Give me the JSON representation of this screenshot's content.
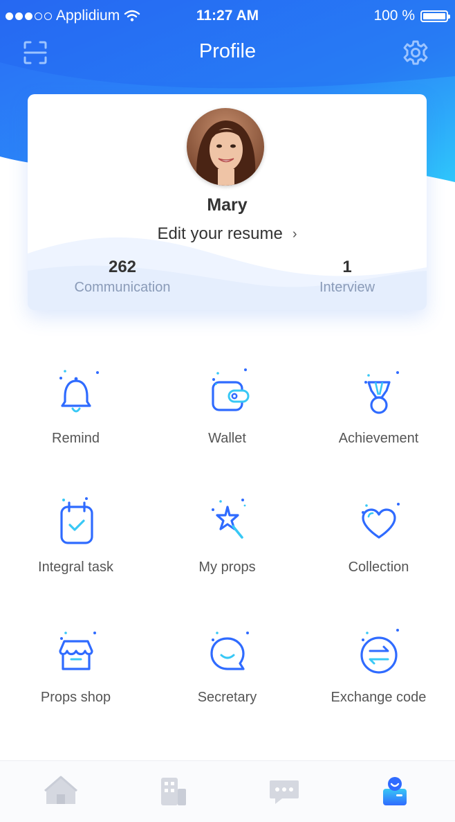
{
  "status_bar": {
    "carrier": "Applidium",
    "time": "11:27 AM",
    "battery": "100 %",
    "icons": [
      "signal-dots",
      "wifi-icon",
      "battery-icon"
    ]
  },
  "nav": {
    "title": "Profile",
    "left_icon": "scan-icon",
    "right_icon": "gear-icon"
  },
  "profile": {
    "name": "Mary",
    "edit_label": "Edit your resume",
    "edit_chevron": "›",
    "stats": [
      {
        "value": "262",
        "label": "Communication"
      },
      {
        "value": "1",
        "label": "Interview"
      }
    ]
  },
  "menu": [
    {
      "label": "Remind",
      "icon": "bell-icon"
    },
    {
      "label": "Wallet",
      "icon": "wallet-icon"
    },
    {
      "label": "Achievement",
      "icon": "medal-icon"
    },
    {
      "label": "Integral task",
      "icon": "calendar-check-icon"
    },
    {
      "label": "My props",
      "icon": "magic-wand-icon"
    },
    {
      "label": "Collection",
      "icon": "heart-icon"
    },
    {
      "label": "Props shop",
      "icon": "shop-icon"
    },
    {
      "label": "Secretary",
      "icon": "chat-smile-icon"
    },
    {
      "label": "Exchange code",
      "icon": "exchange-icon"
    }
  ],
  "tabbar": {
    "tabs": [
      {
        "icon": "home-icon",
        "active": false
      },
      {
        "icon": "building-icon",
        "active": false
      },
      {
        "icon": "message-icon",
        "active": false
      },
      {
        "icon": "profile-icon",
        "active": true
      }
    ]
  },
  "colors": {
    "primary": "#2f6bff",
    "accent": "#38c8f5",
    "header_gradient_start": "#2a6cf5",
    "header_gradient_end": "#2fc1fb",
    "tab_inactive": "#d5d8e0",
    "label_gray": "#8a9bb8"
  }
}
